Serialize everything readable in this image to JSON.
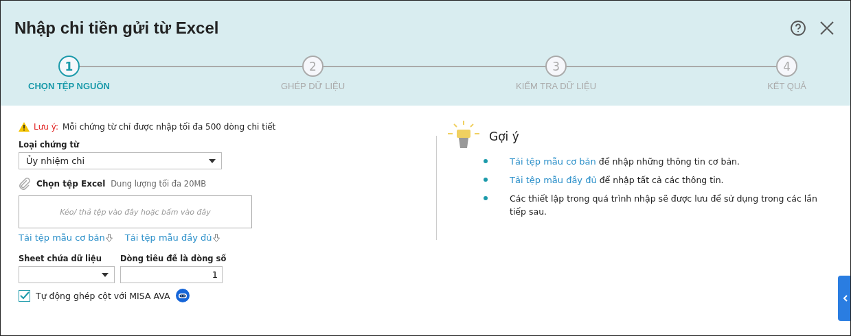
{
  "window": {
    "title": "Nhập chi tiền gửi từ Excel"
  },
  "steps": [
    {
      "number": "1",
      "label": "CHỌN TỆP NGUỒN",
      "selected": true
    },
    {
      "number": "2",
      "label": "GHÉP DỮ LIỆU",
      "selected": false
    },
    {
      "number": "3",
      "label": "KIỂM TRA DỮ LIỆU",
      "selected": false
    },
    {
      "number": "4",
      "label": "KẾT QUẢ",
      "selected": false
    }
  ],
  "notice": {
    "label": "Lưu ý:",
    "text": "Mỗi chứng từ chỉ được nhập tối đa 500 dòng chi tiết"
  },
  "voucher_type": {
    "label": "Loại chứng từ",
    "value": "Ủy nhiệm chi"
  },
  "file_pick": {
    "label": "Chọn tệp Excel",
    "hint": "Dung lượng tối đa 20MB",
    "dropzone": "Kéo/ thả tệp vào đây hoặc bấm vào đây"
  },
  "template_links": [
    "Tải tệp mẫu cơ bản",
    "Tải tệp mẫu đầy đủ"
  ],
  "sheet": {
    "label": "Sheet chứa dữ liệu"
  },
  "header_row": {
    "label": "Dòng tiêu đề là dòng số",
    "value": "1"
  },
  "auto_match": {
    "label": "Tự động ghép cột với MISA AVA",
    "checked": true
  },
  "hints": {
    "title": "Gợi ý",
    "items": [
      {
        "link": "Tải tệp mẫu cơ bản",
        "text": "để nhập những thông tin cơ bản."
      },
      {
        "link": "Tải tệp mẫu đầy đủ",
        "text": "để nhập tất cả các thông tin."
      },
      {
        "text": "Các thiết lập trong quá trình nhập sẽ được lưu để sử dụng trong các lần tiếp sau."
      }
    ]
  }
}
